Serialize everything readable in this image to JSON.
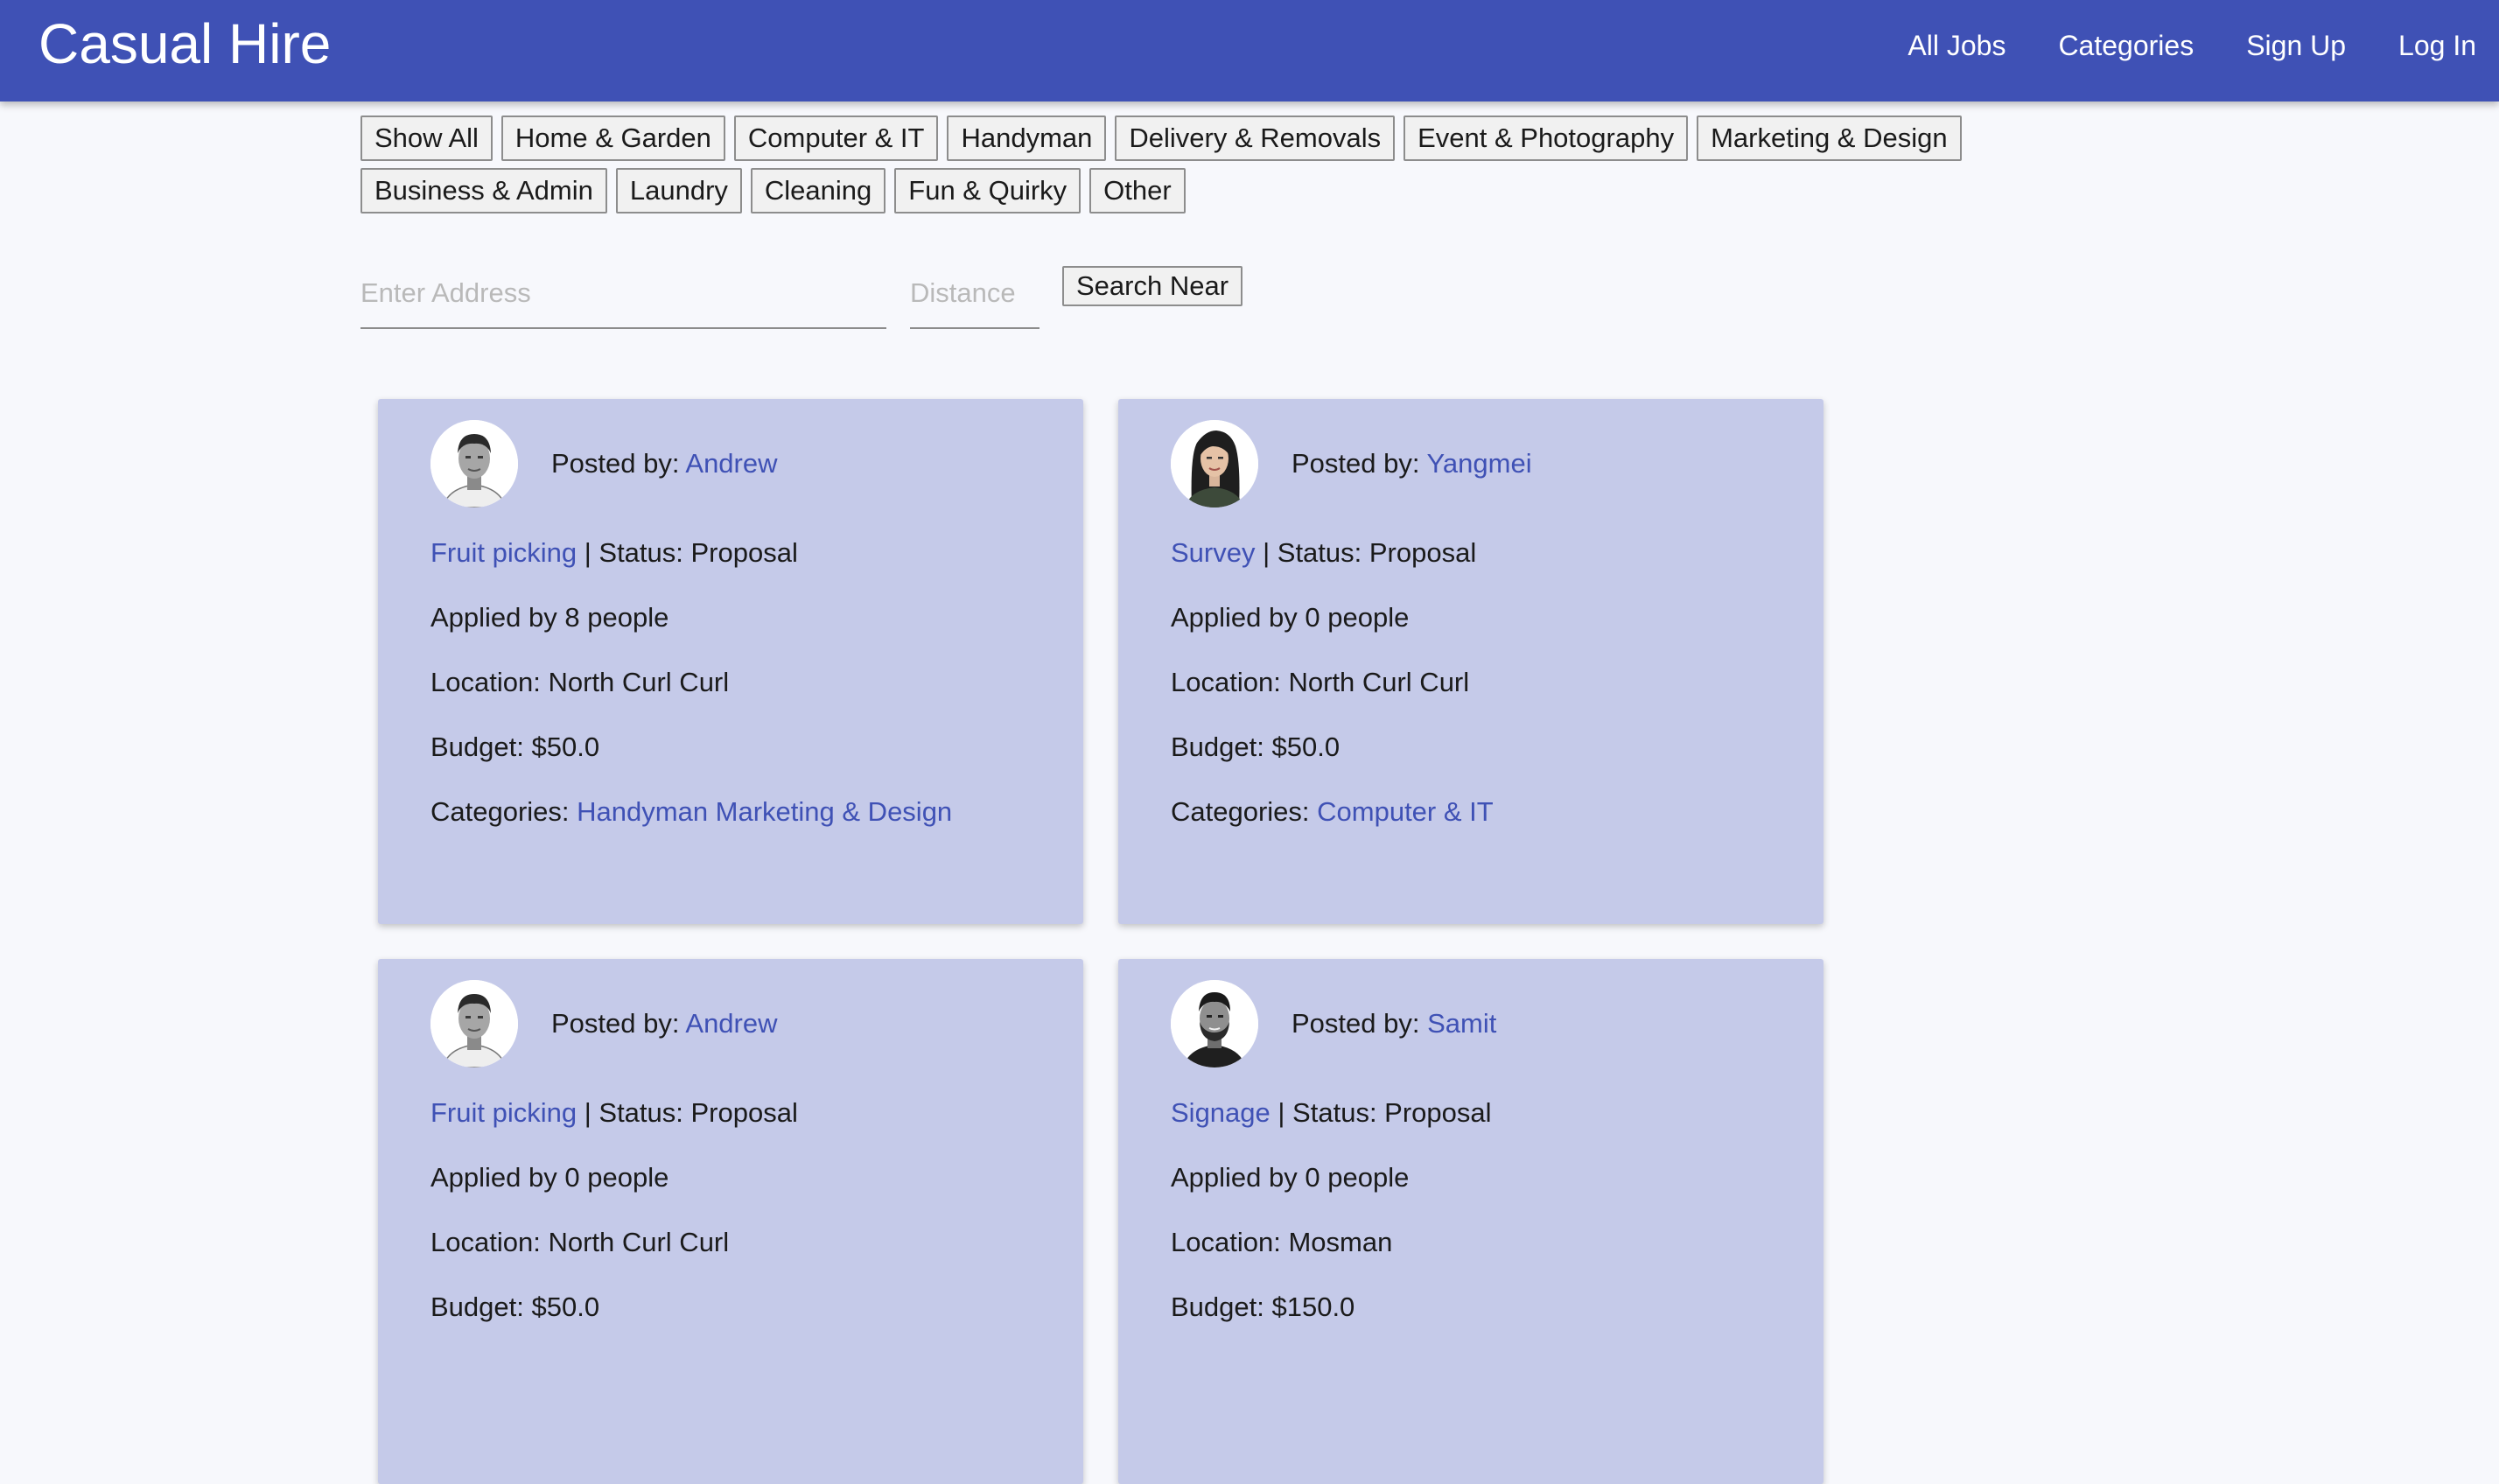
{
  "header": {
    "title": "Casual Hire",
    "nav": {
      "all_jobs": "All Jobs",
      "categories": "Categories",
      "sign_up": "Sign Up",
      "log_in": "Log In"
    }
  },
  "filters": [
    "Show All",
    "Home & Garden",
    "Computer & IT",
    "Handyman",
    "Delivery & Removals",
    "Event & Photography",
    "Marketing & Design",
    "Business & Admin",
    "Laundry",
    "Cleaning",
    "Fun & Quirky",
    "Other"
  ],
  "search": {
    "address_placeholder": "Enter Address",
    "distance_placeholder": "Distance",
    "button": "Search Near"
  },
  "labels": {
    "posted_by": "Posted by: ",
    "status_sep": " | Status: ",
    "applied_prefix": "Applied by ",
    "applied_suffix": " people",
    "location": "Location: ",
    "budget": "Budget: ",
    "categories": "Categories: "
  },
  "jobs": [
    {
      "poster": "Andrew",
      "title": "Fruit picking",
      "status": "Proposal",
      "applied": "8",
      "location": "North Curl Curl",
      "budget": "$50.0",
      "categories": "Handyman Marketing & Design",
      "avatar": "man-short-hair"
    },
    {
      "poster": "Yangmei",
      "title": "Survey",
      "status": "Proposal",
      "applied": "0",
      "location": "North Curl Curl",
      "budget": "$50.0",
      "categories": "Computer & IT",
      "avatar": "woman-long-hair"
    },
    {
      "poster": "Andrew",
      "title": "Fruit picking",
      "status": "Proposal",
      "applied": "0",
      "location": "North Curl Curl",
      "budget": "$50.0",
      "categories": "",
      "avatar": "man-short-hair"
    },
    {
      "poster": "Samit",
      "title": "Signage",
      "status": "Proposal",
      "applied": "0",
      "location": "Mosman",
      "budget": "$150.0",
      "categories": "",
      "avatar": "man-beard"
    }
  ],
  "colors": {
    "primary": "#3f51b5",
    "card_bg": "#c5cae9",
    "page_bg": "#f7f8fc"
  }
}
